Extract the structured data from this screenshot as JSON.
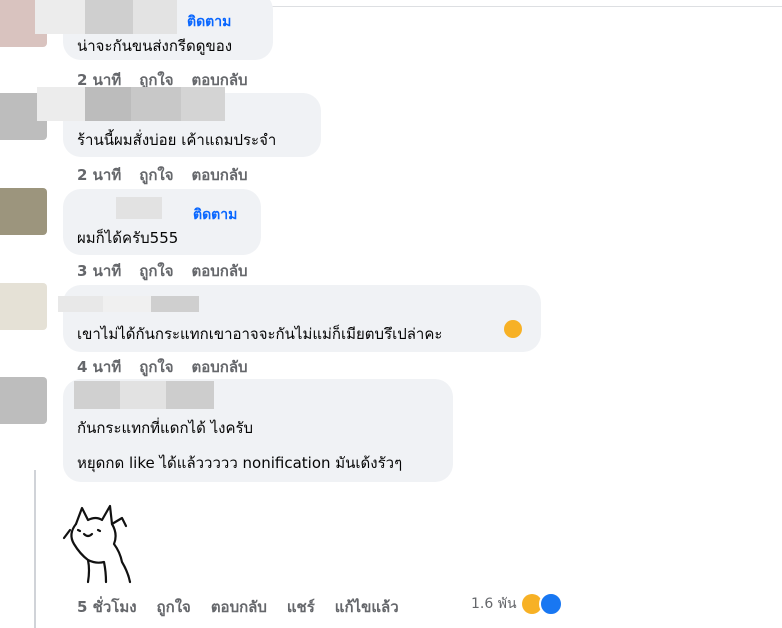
{
  "comments": [
    {
      "follow": "ติดตาม",
      "text": "น่าจะกันขนส่งกรีดดูของ",
      "time": "2 นาที",
      "like": "ถูกใจ",
      "reply": "ตอบกลับ"
    },
    {
      "text": "ร้านนี้ผมสั่งบ่อย เค้าแถมประจำ",
      "time": "2 นาที",
      "like": "ถูกใจ",
      "reply": "ตอบกลับ"
    },
    {
      "follow": "ติดตาม",
      "text": "ผมก็ได้ครับ555",
      "time": "3 นาที",
      "like": "ถูกใจ",
      "reply": "ตอบกลับ"
    },
    {
      "text": "เขาไม่ได้กันกระแทกเขาอาจจะกันไม่แม่ก็เมียตบรึเปล่าคะ",
      "time": "4 นาที",
      "like": "ถูกใจ",
      "reply": "ตอบกลับ"
    },
    {
      "text1": "กันกระแทกที่แดกได้ ไงครับ",
      "text2": "หยุดกด like ได้แล้ววววว nonification มันเด้งรัวๆ",
      "time": "5 ชั่วโมง",
      "like": "ถูกใจ",
      "reply": "ตอบกลับ",
      "share": "แชร์",
      "edited": "แก้ไขแล้ว",
      "reaction_count": "1.6 พัน",
      "reaction_icons": [
        "laughing-reaction-icon",
        "like-reaction-icon"
      ]
    }
  ],
  "colors": {
    "bubble": "#f0f2f5",
    "follow": "#0866ff",
    "meta": "#65676b",
    "like": "#1877f2",
    "laugh": "#f7b125"
  }
}
